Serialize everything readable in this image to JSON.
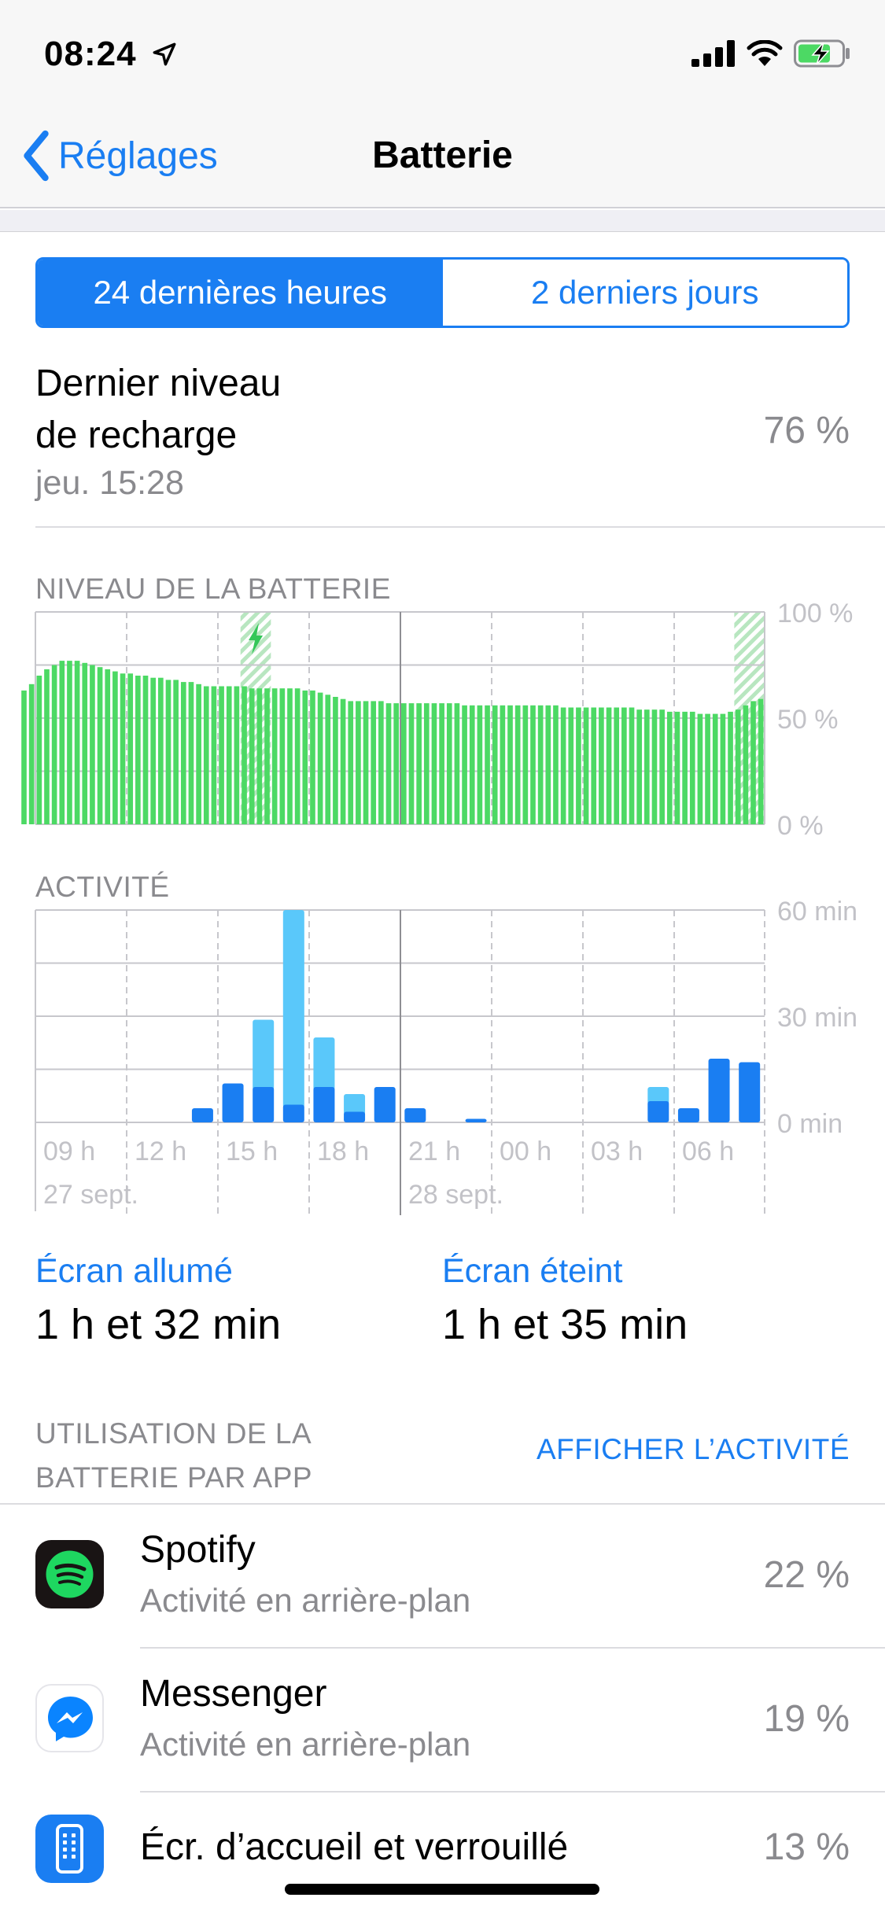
{
  "status_bar": {
    "time": "08:24"
  },
  "nav": {
    "back_label": "Réglages",
    "title": "Batterie"
  },
  "segmented": {
    "option_1": "24 dernières heures",
    "option_2": "2 derniers jours",
    "selected": "24 dernières heures"
  },
  "last_charge": {
    "label_line1": "Dernier niveau",
    "label_line2": "de recharge",
    "date": "jeu. 15:28",
    "value": "76 %"
  },
  "battery_chart": {
    "title": "NIVEAU DE LA BATTERIE",
    "y_tick_labels": [
      "100 %",
      "50 %",
      "0 %"
    ],
    "bar_color": "#4cd964"
  },
  "activity_chart": {
    "title": "ACTIVITÉ",
    "y_tick_labels": [
      "60 min",
      "30 min",
      "0 min"
    ],
    "x_tick_labels": [
      "09 h",
      "12 h",
      "15 h",
      "18 h",
      "21 h",
      "00 h",
      "03 h",
      "06 h"
    ],
    "date_labels": [
      "27 sept.",
      "28 sept."
    ],
    "screen_on_color": "#1a7ef2",
    "screen_off_color": "#5ac8fa"
  },
  "chart_data": [
    {
      "type": "bar",
      "title": "NIVEAU DE LA BATTERIE",
      "ylabel": "",
      "ylim": [
        0,
        100
      ],
      "x_start": "27 sept. 08:00",
      "x_step_minutes": 15,
      "values": [
        63,
        66,
        70,
        73,
        75,
        77,
        77,
        77,
        76,
        75,
        74,
        73,
        72,
        71,
        71,
        70,
        70,
        69,
        69,
        68,
        68,
        67,
        67,
        66,
        65,
        65,
        65,
        65,
        65,
        65,
        64,
        64,
        64,
        64,
        64,
        64,
        64,
        63,
        63,
        62,
        61,
        60,
        59,
        58,
        58,
        58,
        58,
        58,
        57,
        57,
        57,
        57,
        57,
        57,
        57,
        57,
        57,
        57,
        56,
        56,
        56,
        56,
        56,
        56,
        56,
        56,
        56,
        56,
        56,
        56,
        56,
        55,
        55,
        55,
        55,
        55,
        55,
        55,
        55,
        55,
        55,
        54,
        54,
        54,
        54,
        53,
        53,
        53,
        53,
        52,
        52,
        52,
        52,
        53,
        54,
        56,
        58,
        59
      ],
      "charging_periods": [
        [
          "27 sept. 14:45",
          "27 sept. 15:45"
        ],
        [
          "28 sept. 07:00",
          "28 sept. 08:00"
        ]
      ]
    },
    {
      "type": "bar",
      "title": "ACTIVITÉ",
      "ylabel": "",
      "ylim": [
        0,
        60
      ],
      "categories": [
        "08 h",
        "09 h",
        "10 h",
        "11 h",
        "12 h",
        "13 h",
        "14 h",
        "15 h",
        "16 h",
        "17 h",
        "18 h",
        "19 h",
        "20 h",
        "21 h",
        "22 h",
        "23 h",
        "00 h",
        "01 h",
        "02 h",
        "03 h",
        "04 h",
        "05 h",
        "06 h",
        "07 h"
      ],
      "series": [
        {
          "name": "Écran allumé",
          "values": [
            0,
            0,
            0,
            0,
            0,
            4,
            11,
            10,
            5,
            10,
            3,
            10,
            4,
            0,
            1,
            0,
            0,
            0,
            0,
            0,
            6,
            4,
            18,
            17
          ]
        },
        {
          "name": "Écran éteint",
          "values": [
            0,
            0,
            0,
            0,
            0,
            0,
            0,
            19,
            55,
            14,
            5,
            0,
            0,
            0,
            0,
            0,
            0,
            0,
            0,
            0,
            4,
            0,
            0,
            0
          ]
        }
      ]
    }
  ],
  "screen_summary": {
    "on_label": "Écran allumé",
    "on_value": "1 h et 32 min",
    "off_label": "Écran éteint",
    "off_value": "1 h et 35 min"
  },
  "usage": {
    "header_line1": "UTILISATION DE LA",
    "header_line2": "BATTERIE PAR APP",
    "show_activity": "AFFICHER L’ACTIVITÉ",
    "apps": [
      {
        "name": "Spotify",
        "subtitle": "Activité en arrière-plan",
        "percent": "22 %",
        "icon": "spotify-icon"
      },
      {
        "name": "Messenger",
        "subtitle": "Activité en arrière-plan",
        "percent": "19 %",
        "icon": "messenger-icon"
      },
      {
        "name": "Écr. d’accueil et verrouillé",
        "subtitle": "",
        "percent": "13 %",
        "icon": "home-screen-icon"
      }
    ]
  }
}
